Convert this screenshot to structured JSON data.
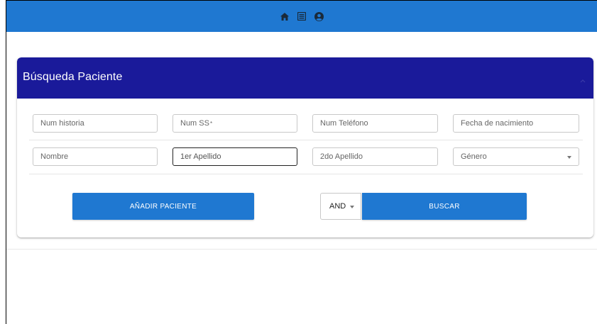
{
  "topbar": {
    "icons": [
      "home-icon",
      "list-icon",
      "user-circle-icon"
    ],
    "color": "#1f78d1"
  },
  "card": {
    "title": "Búsqueda Paciente",
    "header_color": "#1a1a9a",
    "collapse_icon": "chevron-up-icon"
  },
  "form": {
    "row1": {
      "num_historia": "Num historia",
      "num_ss": "Num SS",
      "num_ss_required": "*",
      "num_telefono": "Num Teléfono",
      "fecha_nacimiento": "Fecha de nacimiento"
    },
    "row2": {
      "nombre": "Nombre",
      "apellido1": "1er Apellido",
      "apellido2": "2do Apellido",
      "genero": "Género"
    }
  },
  "actions": {
    "add_patient": "AÑADIR PACIENTE",
    "logic_operator": "AND",
    "search": "BUSCAR",
    "button_color": "#1f78d1"
  }
}
